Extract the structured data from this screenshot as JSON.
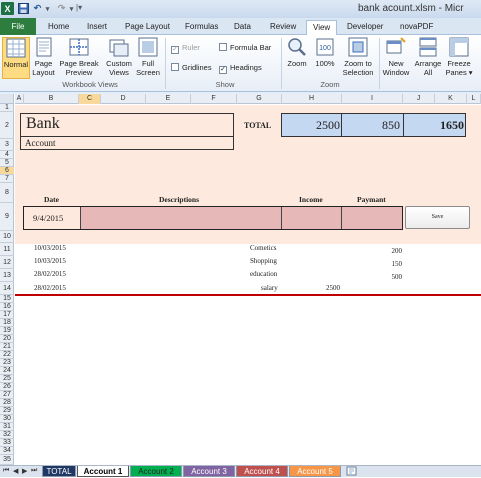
{
  "window": {
    "title": "bank acount.xlsm - Micr"
  },
  "ribbon_tabs": [
    {
      "label": "File"
    },
    {
      "label": "Home"
    },
    {
      "label": "Insert"
    },
    {
      "label": "Page Layout"
    },
    {
      "label": "Formulas"
    },
    {
      "label": "Data"
    },
    {
      "label": "Review"
    },
    {
      "label": "View"
    },
    {
      "label": "Developer"
    },
    {
      "label": "novaPDF"
    }
  ],
  "ribbon": {
    "workbook_views": {
      "group_label": "Workbook Views",
      "normal": "Normal",
      "page_layout": [
        "Page",
        "Layout"
      ],
      "page_break": [
        "Page Break",
        "Preview"
      ],
      "custom_views": [
        "Custom",
        "Views"
      ],
      "full_screen": [
        "Full",
        "Screen"
      ]
    },
    "show": {
      "group_label": "Show",
      "ruler": "Ruler",
      "formula_bar": "Formula Bar",
      "gridlines": "Gridlines",
      "headings": "Headings"
    },
    "zoom": {
      "group_label": "Zoom",
      "zoom": "Zoom",
      "hundred": "100%",
      "zoom_selection": [
        "Zoom to",
        "Selection"
      ]
    },
    "window": {
      "new_window": [
        "New",
        "Window"
      ],
      "arrange_all": [
        "Arrange",
        "All"
      ],
      "freeze_panes": [
        "Freeze",
        "Panes ▾"
      ]
    }
  },
  "columns": [
    "A",
    "B",
    "C",
    "D",
    "E",
    "F",
    "G",
    "H",
    "I",
    "J",
    "K",
    "L"
  ],
  "rows": [
    "1",
    "2",
    "3",
    "4",
    "5",
    "6",
    "7",
    "8",
    "9",
    "10",
    "11",
    "12",
    "13",
    "14",
    "15",
    "16",
    "17",
    "18",
    "19",
    "20",
    "21",
    "22",
    "23",
    "24",
    "25",
    "26",
    "27",
    "28",
    "29",
    "30",
    "31",
    "32",
    "33",
    "34",
    "35"
  ],
  "sheet": {
    "bank_title": "Bank",
    "bank_sub": "Account",
    "total_label": "TOTAL",
    "total_income": "2500",
    "total_payment": "850",
    "total_balance": "1650",
    "headers": {
      "date": "Date",
      "descriptions": "Descriptions",
      "income": "Income",
      "payment": "Paymant"
    },
    "entry_date": "9/4/2015",
    "save_button": "Save",
    "records": [
      {
        "date": "10/03/2015",
        "desc": "Cometics",
        "income": "",
        "payment": "200"
      },
      {
        "date": "10/03/2015",
        "desc": "Shopping",
        "income": "",
        "payment": "150"
      },
      {
        "date": "28/02/2015",
        "desc": "education",
        "income": "",
        "payment": "500"
      },
      {
        "date": "28/02/2015",
        "desc": "salary",
        "income": "2500",
        "payment": ""
      }
    ]
  },
  "sheet_tabs": [
    {
      "label": "TOTAL",
      "color": "#1f3864"
    },
    {
      "label": "Account 1",
      "color": "#ffffff"
    },
    {
      "label": "Account 2",
      "color": "#00b050"
    },
    {
      "label": "Account 3",
      "color": "#8064a2"
    },
    {
      "label": "Account 4",
      "color": "#c0504d"
    },
    {
      "label": "Account 5",
      "color": "#f79646"
    }
  ]
}
